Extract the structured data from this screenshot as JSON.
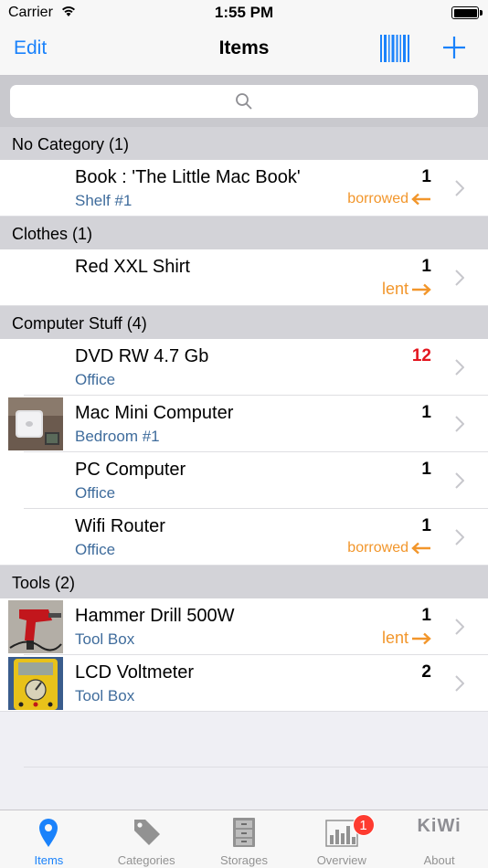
{
  "status_bar": {
    "carrier": "Carrier",
    "time": "1:55 PM"
  },
  "nav": {
    "edit_label": "Edit",
    "title": "Items",
    "barcode_icon": "barcode-icon",
    "add_icon": "plus-icon"
  },
  "search": {
    "placeholder": ""
  },
  "sections": [
    {
      "title": "No Category  (1)",
      "items": [
        {
          "name": "Book : 'The Little Mac Book'",
          "location": "Shelf #1",
          "quantity": "1",
          "status": "borrowed"
        }
      ]
    },
    {
      "title": "Clothes  (1)",
      "items": [
        {
          "name": "Red XXL Shirt",
          "location": "",
          "quantity": "1",
          "status": "lent"
        }
      ]
    },
    {
      "title": "Computer Stuff  (4)",
      "items": [
        {
          "name": "DVD RW 4.7 Gb",
          "location": "Office",
          "quantity": "12",
          "status": ""
        },
        {
          "name": "Mac Mini Computer",
          "location": "Bedroom #1",
          "quantity": "1",
          "status": ""
        },
        {
          "name": "PC Computer",
          "location": "Office",
          "quantity": "1",
          "status": ""
        },
        {
          "name": "Wifi Router",
          "location": "Office",
          "quantity": "1",
          "status": "borrowed"
        }
      ]
    },
    {
      "title": "Tools  (2)",
      "items": [
        {
          "name": "Hammer Drill 500W",
          "location": "Tool Box",
          "quantity": "1",
          "status": "lent"
        },
        {
          "name": "LCD Voltmeter",
          "location": "Tool Box",
          "quantity": "2",
          "status": ""
        }
      ]
    }
  ],
  "tab_bar": {
    "tabs": [
      {
        "label": "Items",
        "icon": "map-pin-icon"
      },
      {
        "label": "Categories",
        "icon": "tag-icon"
      },
      {
        "label": "Storages",
        "icon": "cabinet-icon"
      },
      {
        "label": "Overview",
        "icon": "bar-chart-icon",
        "badge": "1"
      },
      {
        "label": "About",
        "logo_text": "KiWi"
      }
    ]
  },
  "colors": {
    "accent": "#1a82fb",
    "status_orange": "#f2962b",
    "quantity_alert": "#e3161f",
    "location_text": "#3f6c9c",
    "badge": "#fe3b30"
  }
}
